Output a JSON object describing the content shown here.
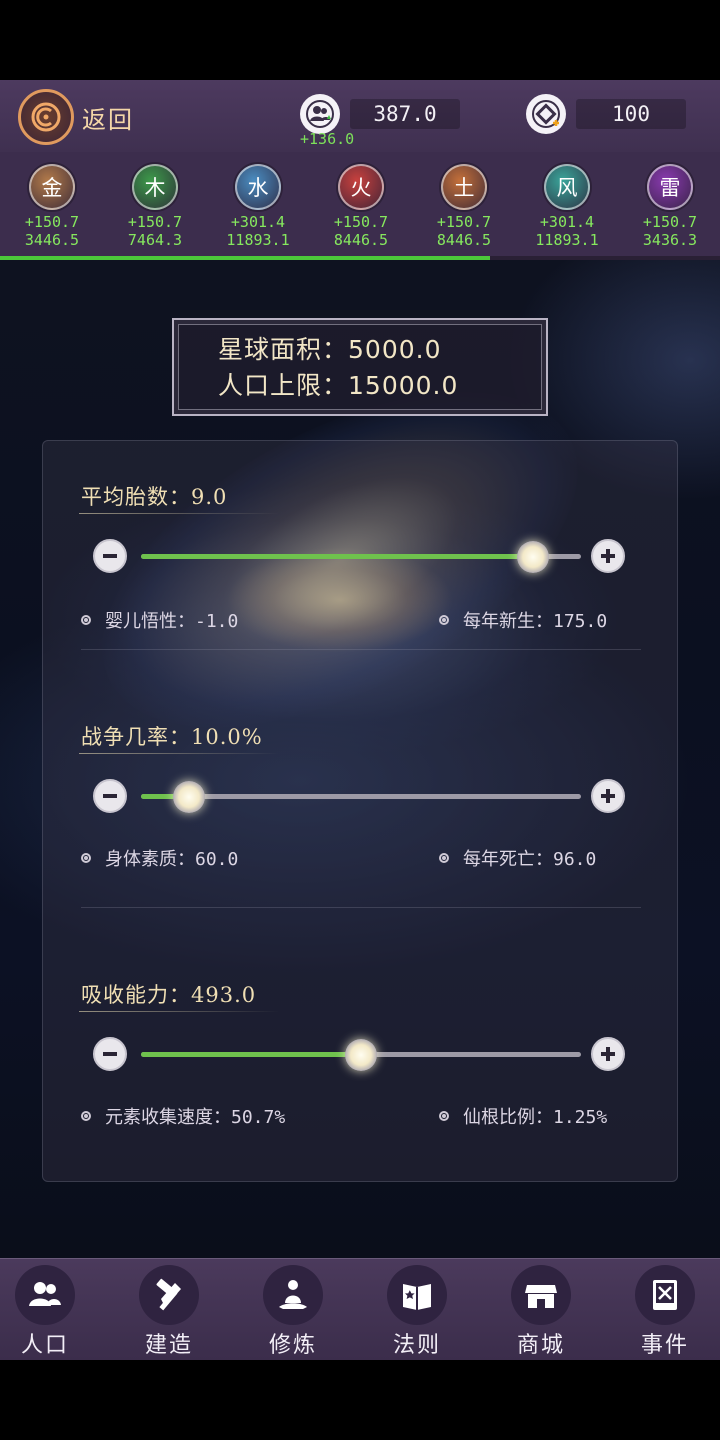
{
  "header": {
    "back_label": "返回",
    "population_value": "387.0",
    "population_delta": "+136.0",
    "currency_value": "100"
  },
  "elements": [
    {
      "char": "金",
      "rate": "+150.7",
      "total": "3446.5",
      "color": "#b27a4a"
    },
    {
      "char": "木",
      "rate": "+150.7",
      "total": "7464.3",
      "color": "#3d9a4a"
    },
    {
      "char": "水",
      "rate": "+301.4",
      "total": "11893.1",
      "color": "#4a8cc0"
    },
    {
      "char": "火",
      "rate": "+150.7",
      "total": "8446.5",
      "color": "#c8413e"
    },
    {
      "char": "土",
      "rate": "+150.7",
      "total": "8446.5",
      "color": "#c4703a"
    },
    {
      "char": "风",
      "rate": "+301.4",
      "total": "11893.1",
      "color": "#3aa59a"
    },
    {
      "char": "雷",
      "rate": "+150.7",
      "total": "3436.3",
      "color": "#8a3ab0"
    }
  ],
  "elements_progress": 0.68,
  "planet": {
    "area_label": "星球面积：",
    "area_value": "5000.0",
    "cap_label": "人口上限：",
    "cap_value": "15000.0"
  },
  "settings": [
    {
      "title": "平均胎数：9.0",
      "level": 0.89,
      "left_stat": "婴儿悟性：-1.0",
      "right_stat": "每年新生：175.0"
    },
    {
      "title": "战争几率：10.0%",
      "level": 0.11,
      "left_stat": "身体素质：60.0",
      "right_stat": "每年死亡：96.0"
    },
    {
      "title": "吸收能力：493.0",
      "level": 0.5,
      "left_stat": "元素收集速度：50.7%",
      "right_stat": "仙根比例：1.25%"
    }
  ],
  "nav": [
    {
      "label": "人口",
      "icon": "people-icon",
      "active": true
    },
    {
      "label": "建造",
      "icon": "hammer-icon",
      "active": false
    },
    {
      "label": "修炼",
      "icon": "meditation-icon",
      "active": false
    },
    {
      "label": "法则",
      "icon": "law-book-icon",
      "active": false
    },
    {
      "label": "商城",
      "icon": "shop-icon",
      "active": false
    },
    {
      "label": "事件",
      "icon": "event-book-icon",
      "active": false
    }
  ]
}
